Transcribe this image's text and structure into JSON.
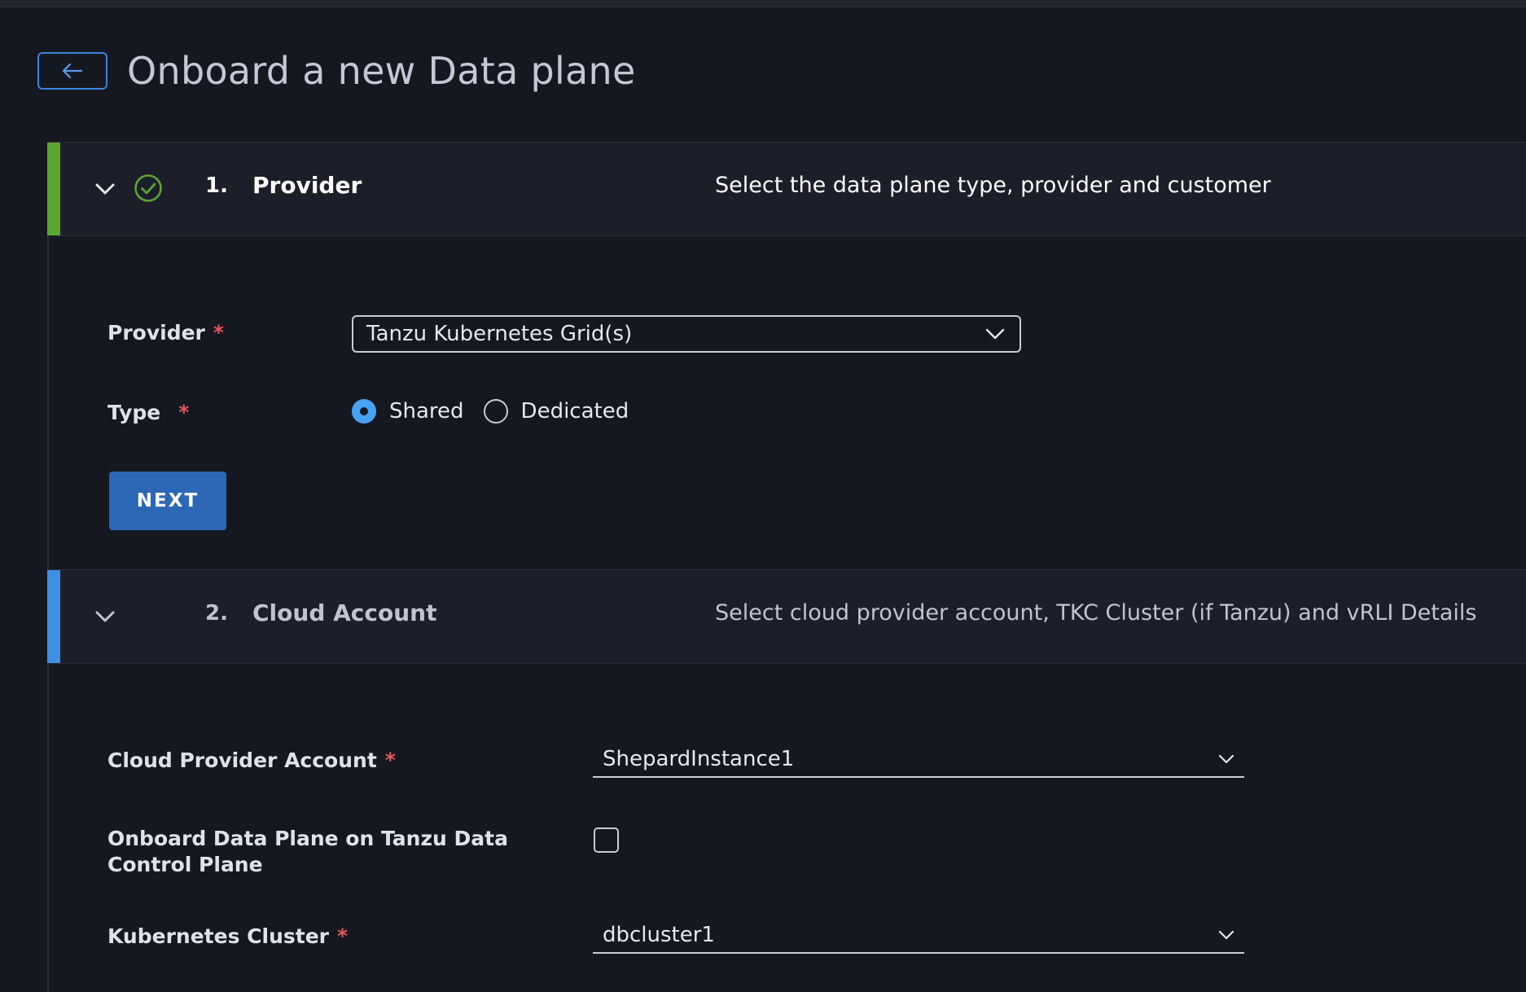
{
  "page": {
    "title": "Onboard a new Data plane"
  },
  "colors": {
    "accent_blue": "#3d8fe3",
    "success_green": "#5ba533",
    "required": "#e2575a",
    "button": "#2b67b4"
  },
  "steps": [
    {
      "number": "1.",
      "name": "Provider",
      "description": "Select the data plane type, provider and customer",
      "status_icon": "check-circle-icon"
    },
    {
      "number": "2.",
      "name": "Cloud Account",
      "description": "Select cloud provider account, TKC Cluster (if Tanzu) and vRLI Details"
    }
  ],
  "provider_form": {
    "provider_label": "Provider",
    "provider_value": "Tanzu Kubernetes Grid(s)",
    "type_label": "Type",
    "type_options": [
      "Shared",
      "Dedicated"
    ],
    "type_selected": "Shared",
    "next_label": "NEXT",
    "required_mark": "*"
  },
  "cloud_form": {
    "account_label": "Cloud Provider Account",
    "account_value": "ShepardInstance1",
    "onboard_label": "Onboard Data Plane on Tanzu Data Control Plane",
    "onboard_checked": false,
    "cluster_label": "Kubernetes Cluster",
    "cluster_value": "dbcluster1",
    "required_mark": "*"
  }
}
